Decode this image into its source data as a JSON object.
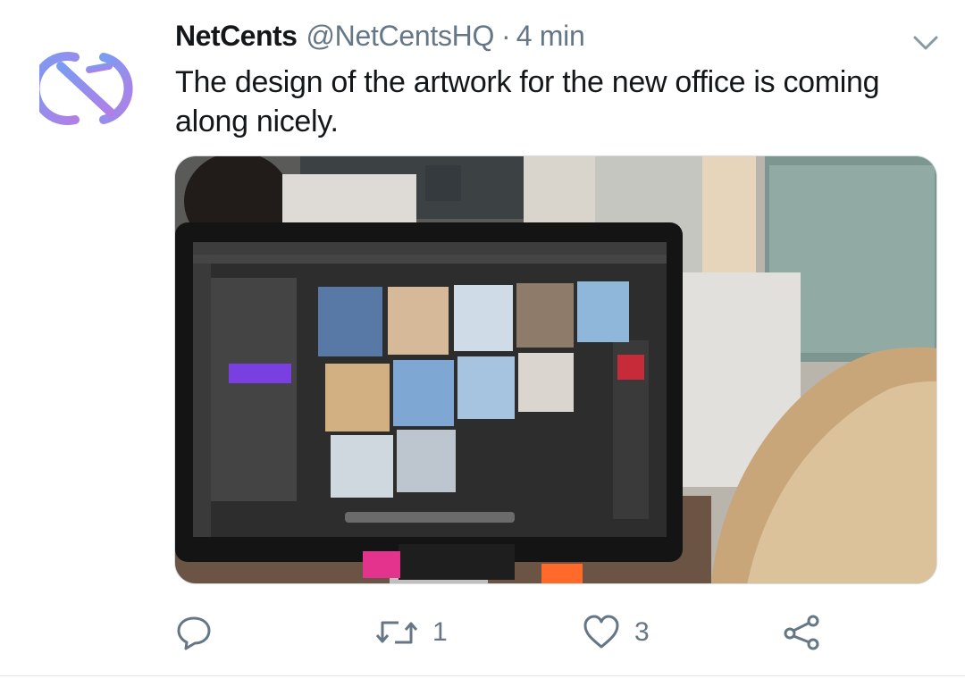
{
  "tweet": {
    "author_name": "NetCents",
    "author_handle": "@NetCentsHQ",
    "separator": "·",
    "timestamp": "4 min",
    "text": "The design of the artwork for the new office is coming along nicely.",
    "media_type": "photo",
    "avatar_icon": "netcents-logo-icon"
  },
  "actions": {
    "reply_icon": "reply-icon",
    "retweet_icon": "retweet-icon",
    "retweet_count": "1",
    "like_icon": "heart-icon",
    "like_count": "3",
    "share_icon": "share-icon"
  },
  "colors": {
    "text_primary": "#14171a",
    "text_secondary": "#657786",
    "divider": "#e1e8ed",
    "logo_gradient_start": "#7b9af2",
    "logo_gradient_end": "#b583e8"
  }
}
